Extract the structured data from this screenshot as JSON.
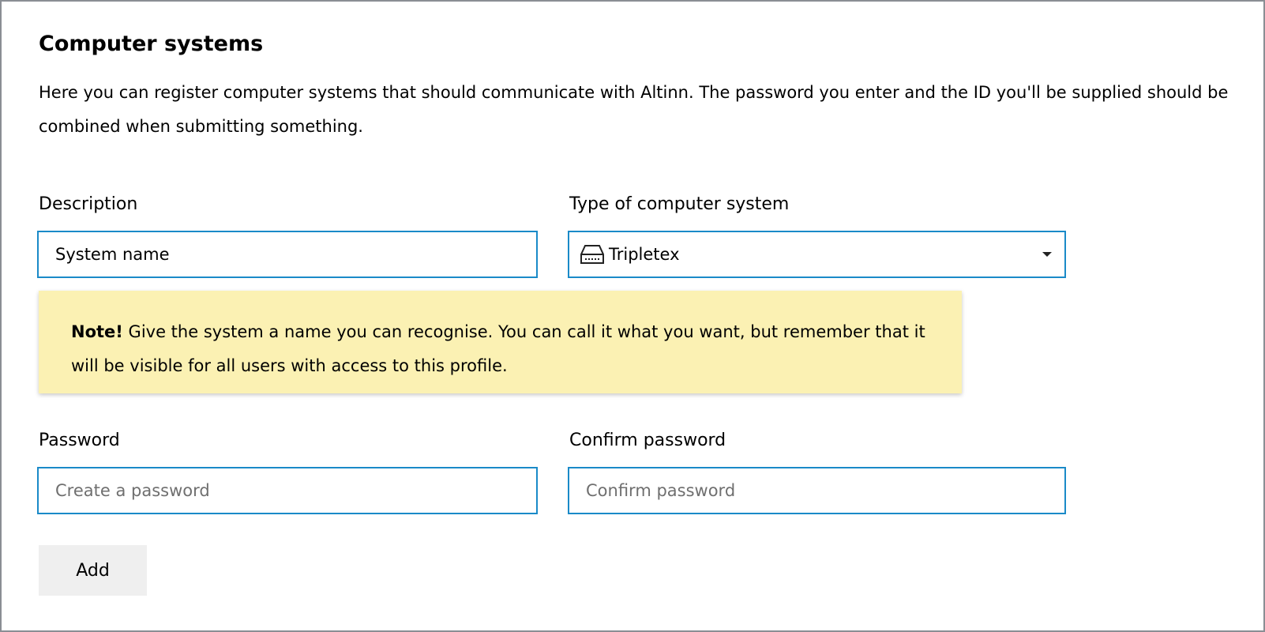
{
  "section": {
    "title": "Computer systems",
    "intro": "Here you can register computer systems that should communicate with Altinn. The password you enter and the ID you'll be supplied should be combined when submitting something."
  },
  "description": {
    "label": "Description",
    "value": "System name"
  },
  "system_type": {
    "label": "Type of computer system",
    "selected": "Tripletex",
    "icon": "server-icon"
  },
  "note": {
    "strong": "Note!",
    "text": " Give the system a name you can recognise. You can call it what you want, but remember that it will be visible for all users with access to this profile."
  },
  "password": {
    "label": "Password",
    "placeholder": "Create a password"
  },
  "confirm_password": {
    "label": "Confirm password",
    "placeholder": "Confirm password"
  },
  "add_button": {
    "label": "Add"
  },
  "colors": {
    "field_border": "#1a8ac8",
    "note_background": "#fbf1b3",
    "button_background": "#efefef"
  }
}
